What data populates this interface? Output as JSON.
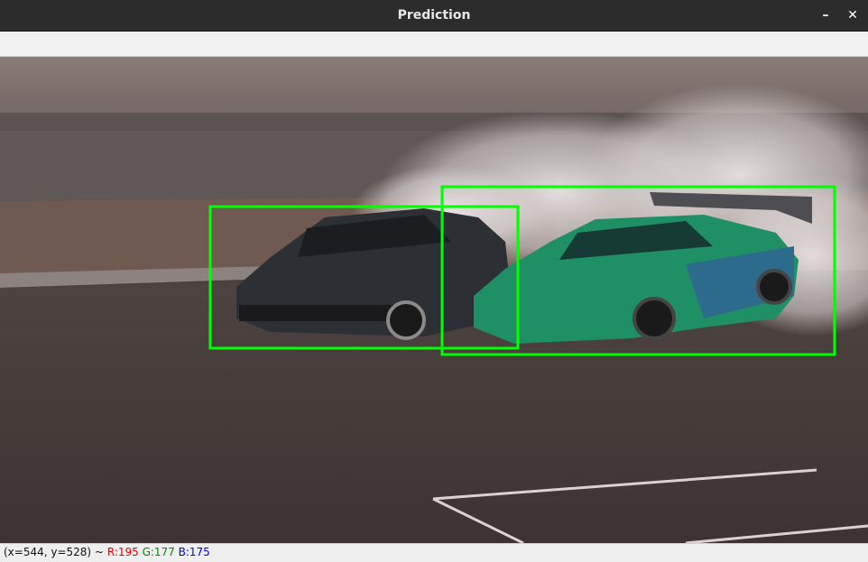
{
  "window": {
    "title": "Prediction",
    "minimize_glyph": "–",
    "close_glyph": "✕"
  },
  "image": {
    "description_scene": "drift-cars-with-tire-smoke",
    "detections": [
      {
        "label": "car",
        "color": "#00ff00"
      },
      {
        "label": "car",
        "color": "#00ff00"
      }
    ],
    "box_color": "#00ff00"
  },
  "statusbar": {
    "coords": "(x=544, y=528) ~",
    "r": "R:195",
    "g": "G:177",
    "b": "B:175",
    "r_color": "#e00000",
    "g_color": "#008a00",
    "b_color": "#0000e0"
  }
}
